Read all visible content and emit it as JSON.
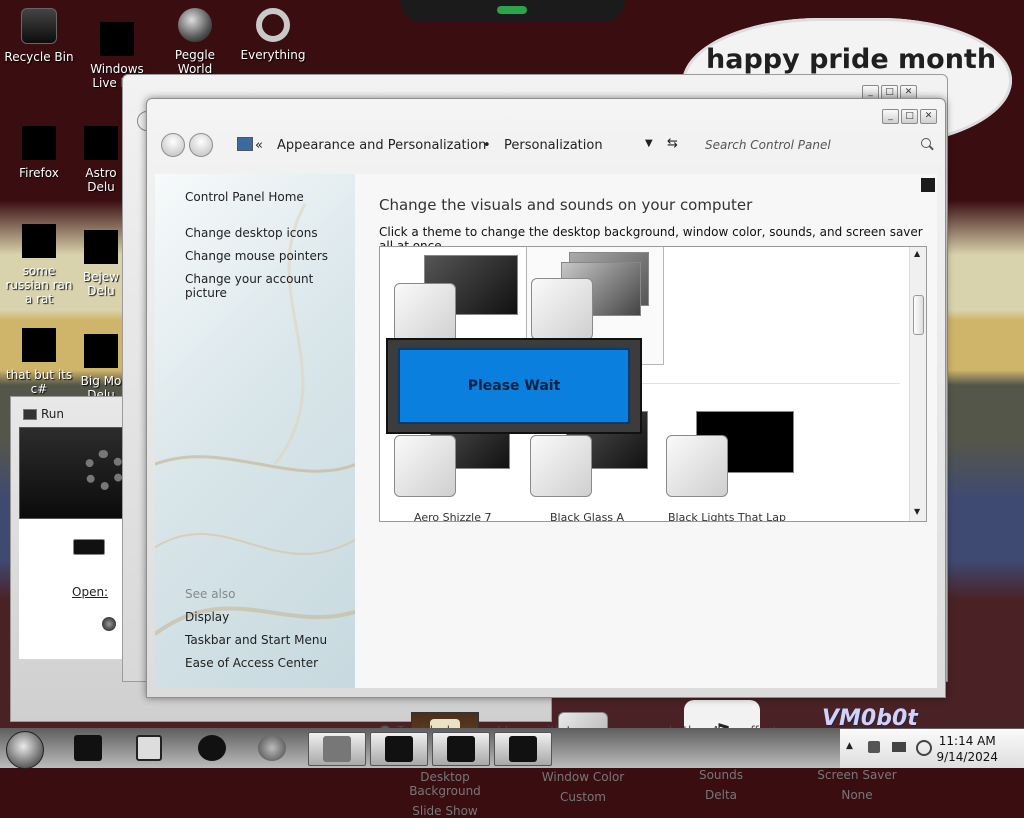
{
  "desktop": {
    "icons": [
      {
        "label": "Recycle Bin",
        "icon": "recycle-bin-icon"
      },
      {
        "label": "Windows Live Mai",
        "icon": "windows-live-mail-icon"
      },
      {
        "label": "Peggle World",
        "icon": "peggle-icon"
      },
      {
        "label": "Everything",
        "icon": "everything-icon"
      },
      {
        "label": "Firefox",
        "icon": "firefox-icon"
      },
      {
        "label": "Astro Delu",
        "icon": "astro-icon"
      },
      {
        "label": "some russian ran a rat",
        "icon": "file-icon"
      },
      {
        "label": "Bejew Delu",
        "icon": "bejeweled-icon"
      },
      {
        "label": "that but its c#",
        "icon": "file-icon"
      },
      {
        "label": "Big Mo Delu",
        "icon": "game-icon"
      }
    ],
    "bubble_text": "happy pride month",
    "watermark": "VM0b0t"
  },
  "run_dialog": {
    "title": "Run",
    "open_label": "Open:"
  },
  "window": {
    "breadcrumb": {
      "chevrons": "«",
      "part1": "Appearance and Personalization",
      "separator": "•",
      "part2": "Personalization"
    },
    "search_placeholder": "Search Control Panel",
    "sidebar": {
      "home": "Control Panel Home",
      "links": [
        "Change desktop icons",
        "Change mouse pointers",
        "Change your account picture"
      ],
      "see_also_label": "See also",
      "see_also": [
        "Display",
        "Taskbar and Start Menu",
        "Ease of Access Center"
      ]
    },
    "heading": "Change the visuals and sounds on your computer",
    "subheading": "Click a theme to change the desktop background, window color, sounds, and screen saver all at once.",
    "themes_partial_labels": [
      "Aero Shizzle 7",
      "Black Glass A",
      "Black Lights That Lap"
    ],
    "please_wait": "Please Wait",
    "options": [
      {
        "title": "Desktop Background",
        "value": "Slide Show",
        "icon": "desktop-background-icon"
      },
      {
        "title": "Window Color",
        "value": "Custom",
        "icon": "window-color-icon"
      },
      {
        "title": "Sounds",
        "value": "Delta",
        "icon": "sounds-icon"
      },
      {
        "title": "Screen Saver",
        "value": "None",
        "icon": "screen-saver-icon"
      }
    ],
    "troubleshoot": "Troubleshoot problems with transparency and other Aero effects"
  },
  "taskbar": {
    "time": "11:14 AM",
    "date": "9/14/2024"
  }
}
